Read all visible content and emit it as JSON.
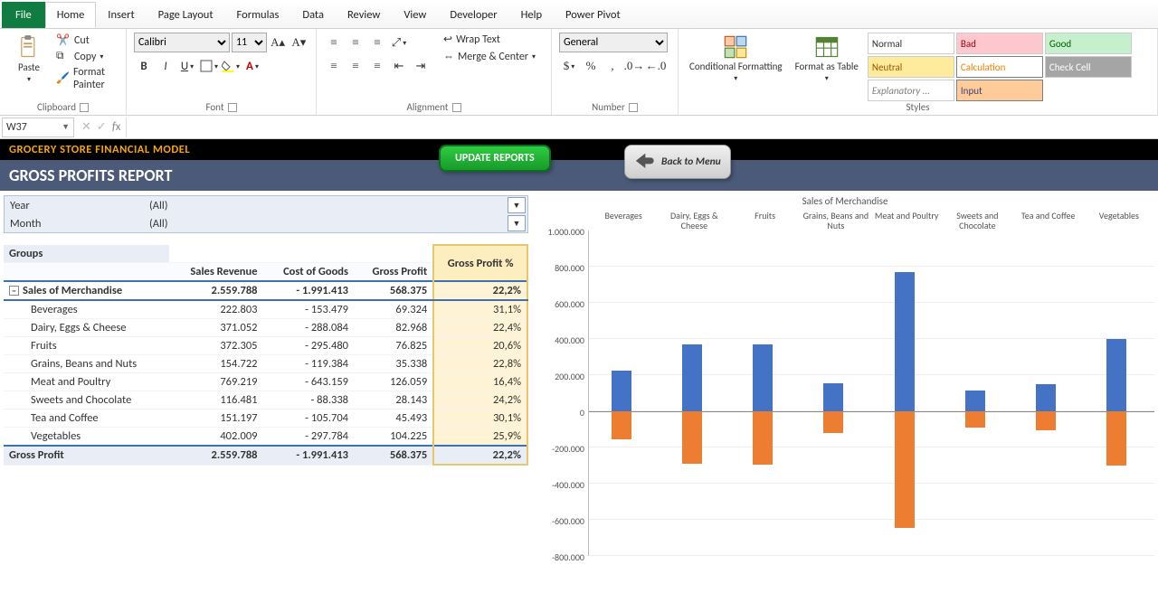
{
  "ribbon_tabs": [
    "File",
    "Home",
    "Insert",
    "Page Layout",
    "Formulas",
    "Data",
    "Review",
    "View",
    "Developer",
    "Help",
    "Power Pivot"
  ],
  "active_tab": "Home",
  "clipboard": {
    "title": "Clipboard",
    "paste": "Paste",
    "cut": "Cut",
    "copy": "Copy",
    "painter": "Format Painter"
  },
  "font": {
    "title": "Font",
    "name": "Calibri",
    "size": "11"
  },
  "alignment": {
    "title": "Alignment",
    "wrap": "Wrap Text",
    "merge": "Merge & Center"
  },
  "number": {
    "title": "Number",
    "format": "General"
  },
  "styles_group": {
    "title": "Styles",
    "cond": "Conditional Formatting",
    "table": "Format as Table"
  },
  "styles": {
    "normal": "Normal",
    "bad": "Bad",
    "good": "Good",
    "neutral": "Neutral",
    "calc": "Calculation",
    "check": "Check Cell",
    "expl": "Explanatory ...",
    "input": "Input"
  },
  "namebox": "W37",
  "header": {
    "title1": "GROCERY STORE FINANCIAL MODEL",
    "title2": "GROSS PROFITS REPORT",
    "update": "UPDATE REPORTS",
    "back": "Back to Menu"
  },
  "slicer": {
    "year_lbl": "Year",
    "year_val": "(All)",
    "month_lbl": "Month",
    "month_val": "(All)"
  },
  "pivot": {
    "hdr_groups": "Groups",
    "hdr_rev": "Sales Revenue",
    "hdr_cogs": "Cost of Goods",
    "hdr_gp": "Gross Profit",
    "hdr_gpp": "Gross Profit %",
    "sales_lbl": "Sales of Merchandise",
    "sales": [
      "2.559.788",
      "- 1.991.413",
      "568.375",
      "22,2%"
    ],
    "rows": [
      {
        "lbl": "Beverages",
        "v": [
          "222.803",
          "- 153.479",
          "69.324",
          "31,1%"
        ]
      },
      {
        "lbl": "Dairy, Eggs & Cheese",
        "v": [
          "371.052",
          "- 288.084",
          "82.968",
          "22,4%"
        ]
      },
      {
        "lbl": "Fruits",
        "v": [
          "372.305",
          "- 295.480",
          "76.825",
          "20,6%"
        ]
      },
      {
        "lbl": "Grains, Beans and Nuts",
        "v": [
          "154.722",
          "- 119.384",
          "35.338",
          "22,8%"
        ]
      },
      {
        "lbl": "Meat and Poultry",
        "v": [
          "769.219",
          "- 643.159",
          "126.059",
          "16,4%"
        ]
      },
      {
        "lbl": "Sweets and Chocolate",
        "v": [
          "116.481",
          "- 88.338",
          "28.143",
          "24,2%"
        ]
      },
      {
        "lbl": "Tea and Coffee",
        "v": [
          "151.197",
          "- 105.704",
          "45.493",
          "30,1%"
        ]
      },
      {
        "lbl": "Vegetables",
        "v": [
          "402.009",
          "- 297.784",
          "104.225",
          "25,9%"
        ]
      }
    ],
    "grand_lbl": "Gross Profit",
    "grand": [
      "2.559.788",
      "- 1.991.413",
      "568.375",
      "22,2%"
    ]
  },
  "chart_data": {
    "type": "bar",
    "title": "Sales of Merchandise",
    "categories": [
      "Beverages",
      "Dairy, Eggs & Cheese",
      "Fruits",
      "Grains, Beans and Nuts",
      "Meat and Poultry",
      "Sweets and Chocolate",
      "Tea and Coffee",
      "Vegetables"
    ],
    "series": [
      {
        "name": "Sales Revenue",
        "values": [
          222803,
          371052,
          372305,
          154722,
          769219,
          116481,
          151197,
          402009
        ]
      },
      {
        "name": "Cost of Goods",
        "values": [
          -153479,
          -288084,
          -295480,
          -119384,
          -643159,
          -88338,
          -105704,
          -297784
        ]
      }
    ],
    "ylim": [
      -800000,
      1000000
    ],
    "y_ticks": [
      "1.000.000",
      "800.000",
      "600.000",
      "400.000",
      "200.000",
      "0",
      "-200.000",
      "-400.000",
      "-600.000",
      "-800.000"
    ]
  }
}
